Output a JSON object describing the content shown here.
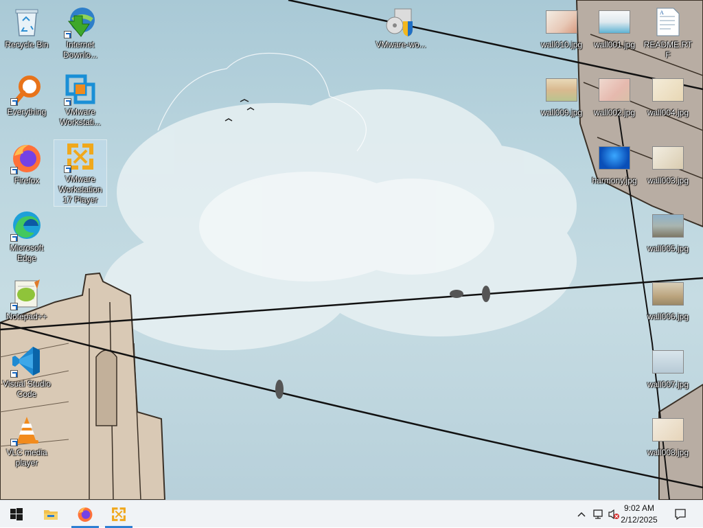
{
  "desktop_icons_left": [
    {
      "name": "recycle-bin",
      "label": "Recycle Bin",
      "icon": "recycle-bin-icon"
    },
    {
      "name": "internet-download-manager",
      "label": "Internet Downlo...",
      "icon": "idm-icon"
    },
    {
      "name": "everything",
      "label": "Everything",
      "icon": "everything-search-icon"
    },
    {
      "name": "vmware-workstation",
      "label": "VMware Workstati...",
      "icon": "vmware-workstation-icon"
    },
    {
      "name": "firefox",
      "label": "Firefox",
      "icon": "firefox-icon"
    },
    {
      "name": "vmware-player",
      "label": "VMware Workstation 17 Player",
      "icon": "vmware-player-icon"
    },
    {
      "name": "microsoft-edge",
      "label": "Microsoft Edge",
      "icon": "edge-icon"
    },
    {
      "name": "notepad-plus-plus",
      "label": "Notepad++",
      "icon": "notepadpp-icon"
    },
    {
      "name": "visual-studio-code",
      "label": "Visual Studio Code",
      "icon": "vscode-icon"
    },
    {
      "name": "vlc",
      "label": "VLC media player",
      "icon": "vlc-icon"
    }
  ],
  "desktop_icons_right": [
    {
      "name": "vmware-installer",
      "label": "VMware-wo...",
      "icon": "installer-icon"
    },
    {
      "name": "wall010",
      "label": "wall010.jpg"
    },
    {
      "name": "wall001",
      "label": "wall001.jpg"
    },
    {
      "name": "readme",
      "label": "README.RTF"
    },
    {
      "name": "wall009",
      "label": "wall009.jpg"
    },
    {
      "name": "wall002",
      "label": "wall002.jpg"
    },
    {
      "name": "wall004",
      "label": "wall004.jpg"
    },
    {
      "name": "harmony",
      "label": "harmony.jpg"
    },
    {
      "name": "wall003",
      "label": "wall003.jpg"
    },
    {
      "name": "wall005",
      "label": "wall005.jpg"
    },
    {
      "name": "wall006",
      "label": "wall006.jpg"
    },
    {
      "name": "wall007",
      "label": "wall007.jpg"
    },
    {
      "name": "wall008",
      "label": "wall008.jpg"
    }
  ],
  "taskbar": {
    "pinned": [
      "start-icon",
      "file-explorer-icon",
      "firefox-icon",
      "vmware-player-icon"
    ],
    "clock_time": "9:02 AM",
    "clock_date": "2/12/2025",
    "tray": [
      "chevron-up-icon",
      "network-icon",
      "volume-muted-icon",
      "notifications-icon"
    ]
  },
  "colors": {
    "accent": "#2d7fd3",
    "taskbar": "#f0f3f6",
    "sky": "#b7d0da"
  }
}
